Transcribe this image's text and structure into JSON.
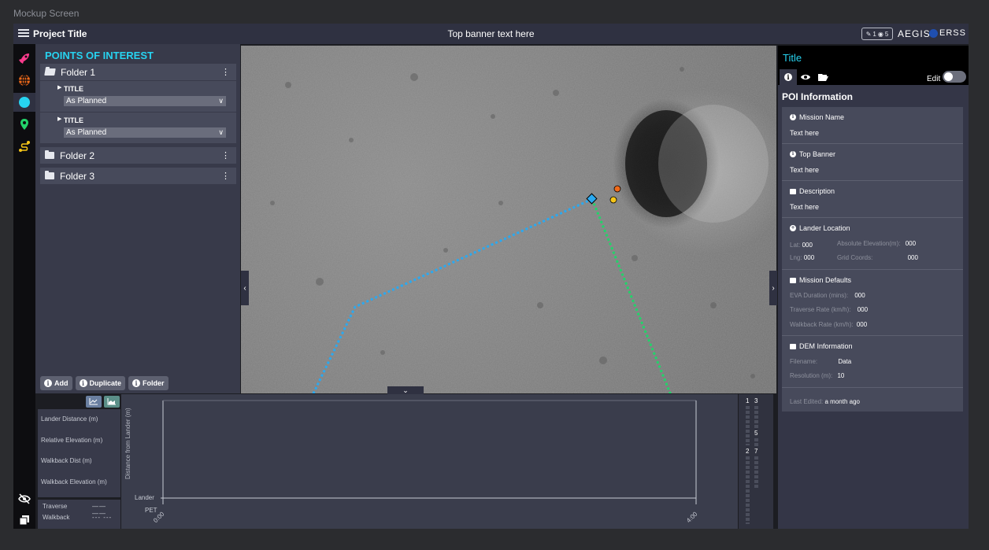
{
  "frame_label": "Mockup Screen",
  "topbar": {
    "project_title": "Project Title",
    "banner": "Top banner text here",
    "edit_count": "1",
    "view_count": "5",
    "brand": "AEGIS",
    "partner": "ERSS"
  },
  "poi": {
    "title": "POINTS OF INTEREST",
    "folders": [
      {
        "name": "Folder 1",
        "items": [
          {
            "title": "TITLE",
            "status": "As Planned"
          },
          {
            "title": "TITLE",
            "status": "As Planned"
          }
        ]
      },
      {
        "name": "Folder 2"
      },
      {
        "name": "Folder 3"
      }
    ],
    "buttons": {
      "add": "Add",
      "duplicate": "Duplicate",
      "folder": "Folder"
    }
  },
  "right": {
    "title": "Title",
    "edit_label": "Edit",
    "section_title": "POI Information",
    "mission_name": {
      "label": "Mission Name",
      "value": "Text here"
    },
    "top_banner": {
      "label": "Top Banner",
      "value": "Text here"
    },
    "description": {
      "label": "Description",
      "value": "Text here"
    },
    "lander_location": {
      "label": "Lander Location",
      "lat_label": "Lat:",
      "lat": "000",
      "lng_label": "Lng:",
      "lng": "000",
      "elev_label": "Absolute Elevation(m):",
      "elev": "000",
      "grid_label": "Grid Coords:",
      "grid": "000"
    },
    "mission_defaults": {
      "label": "Mission Defaults",
      "eva_label": "EVA Duration (mins):",
      "eva": "000",
      "traverse_label": "Traverse Rate (km/h):",
      "traverse": "000",
      "walkback_label": "Walkback Rate (km/h):",
      "walkback": "000"
    },
    "dem": {
      "label": "DEM Information",
      "filename_label": "Filename:",
      "filename": "Data",
      "resolution_label": "Resolution (m):",
      "resolution": "10"
    },
    "last_edited_label": "Last Edited:",
    "last_edited": "a month ago"
  },
  "graph": {
    "metrics": [
      "Lander Distance (m)",
      "Relative Elevation (m)",
      "Walkback Dist (m)",
      "Walkback Elevation (m)"
    ],
    "legend": [
      {
        "name": "Traverse",
        "line": "—— ——"
      },
      {
        "name": "Walkback",
        "line": "--- ---"
      }
    ],
    "ylabel": "Distance from Lander (m)",
    "lander_label": "Lander",
    "x_label": "PET",
    "x_ticks": [
      "0:00",
      "4:00"
    ]
  },
  "timeline": {
    "labels": [
      "1",
      "3",
      "5",
      "2",
      "7"
    ]
  },
  "colors": {
    "accent": "#27d3f0",
    "traverse_path": "#2aa9f0",
    "walkback_path": "#22d36a",
    "marker_orange": "#f06a1a",
    "marker_yellow": "#f5c518"
  }
}
